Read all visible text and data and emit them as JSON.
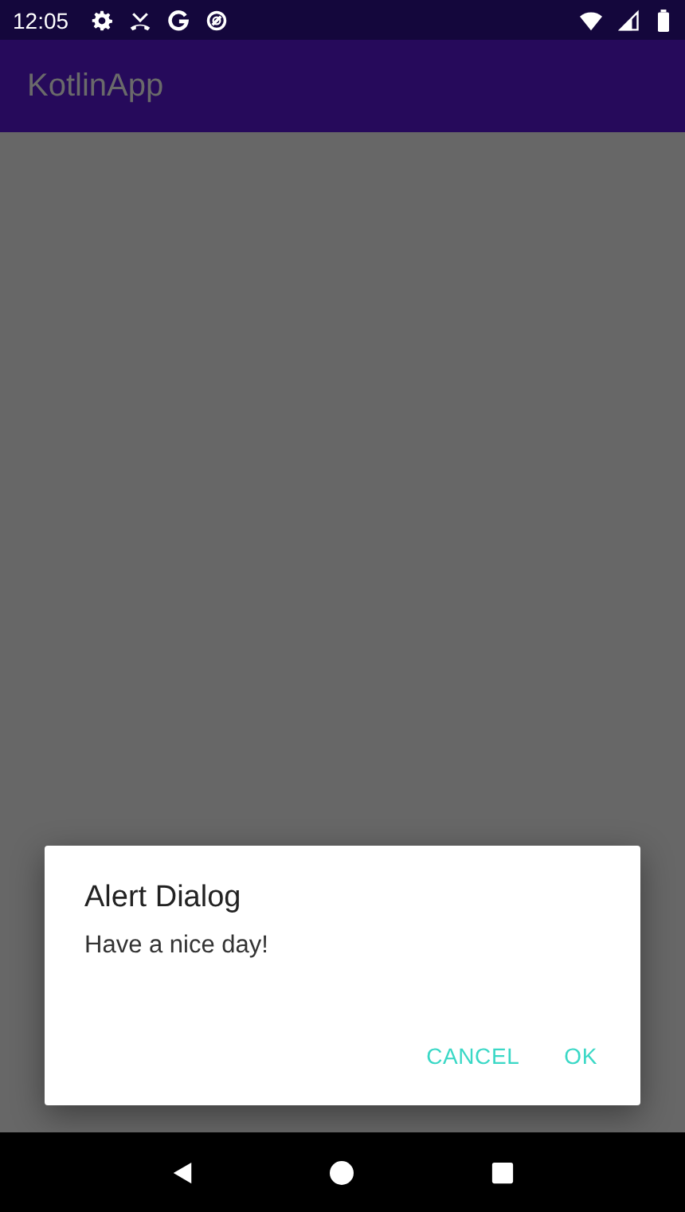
{
  "status_bar": {
    "time": "12:05"
  },
  "app_bar": {
    "title": "KotlinApp"
  },
  "dialog": {
    "title": "Alert Dialog",
    "message": "Have a nice day!",
    "buttons": [
      "CANCEL",
      "OK"
    ]
  }
}
